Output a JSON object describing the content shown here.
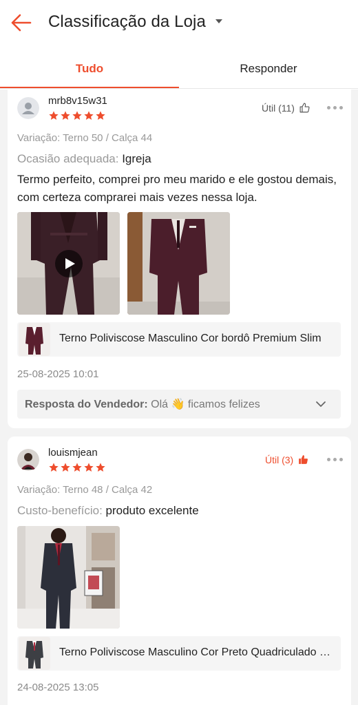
{
  "header": {
    "title": "Classificação da Loja"
  },
  "tabs": {
    "all": "Tudo",
    "reply": "Responder"
  },
  "colors": {
    "accent": "#ee4d2d",
    "star": "#ee4d2d"
  },
  "reviews": [
    {
      "username": "mrb8v15w31",
      "rating": 5,
      "useful": "Útil (11)",
      "useful_active": false,
      "variation": "Variação: Terno 50 / Calça 44",
      "occasion_label": "Ocasião adequada:",
      "occasion_value": "Igreja",
      "comment": "Termo perfeito, comprei pro meu marido e ele gostou demais, com certeza comprarei mais vezes nessa loja.",
      "product_name": "Terno Poliviscose Masculino Cor bordô Premium Slim",
      "date": "25-08-2025 10:01",
      "reply_label": "Resposta do Vendedor:",
      "reply_preview": "Olá 👋 ficamos felizes"
    },
    {
      "username": "louismjean",
      "rating": 5,
      "useful": "Útil (3)",
      "useful_active": true,
      "variation": "Variação: Terno 48 / Calça 42",
      "occasion_label": "Custo-benefício:",
      "occasion_value": "produto excelente",
      "product_name": "Terno Poliviscose Masculino Cor Preto Quadriculado Slim",
      "date": "24-08-2025 13:05"
    }
  ]
}
